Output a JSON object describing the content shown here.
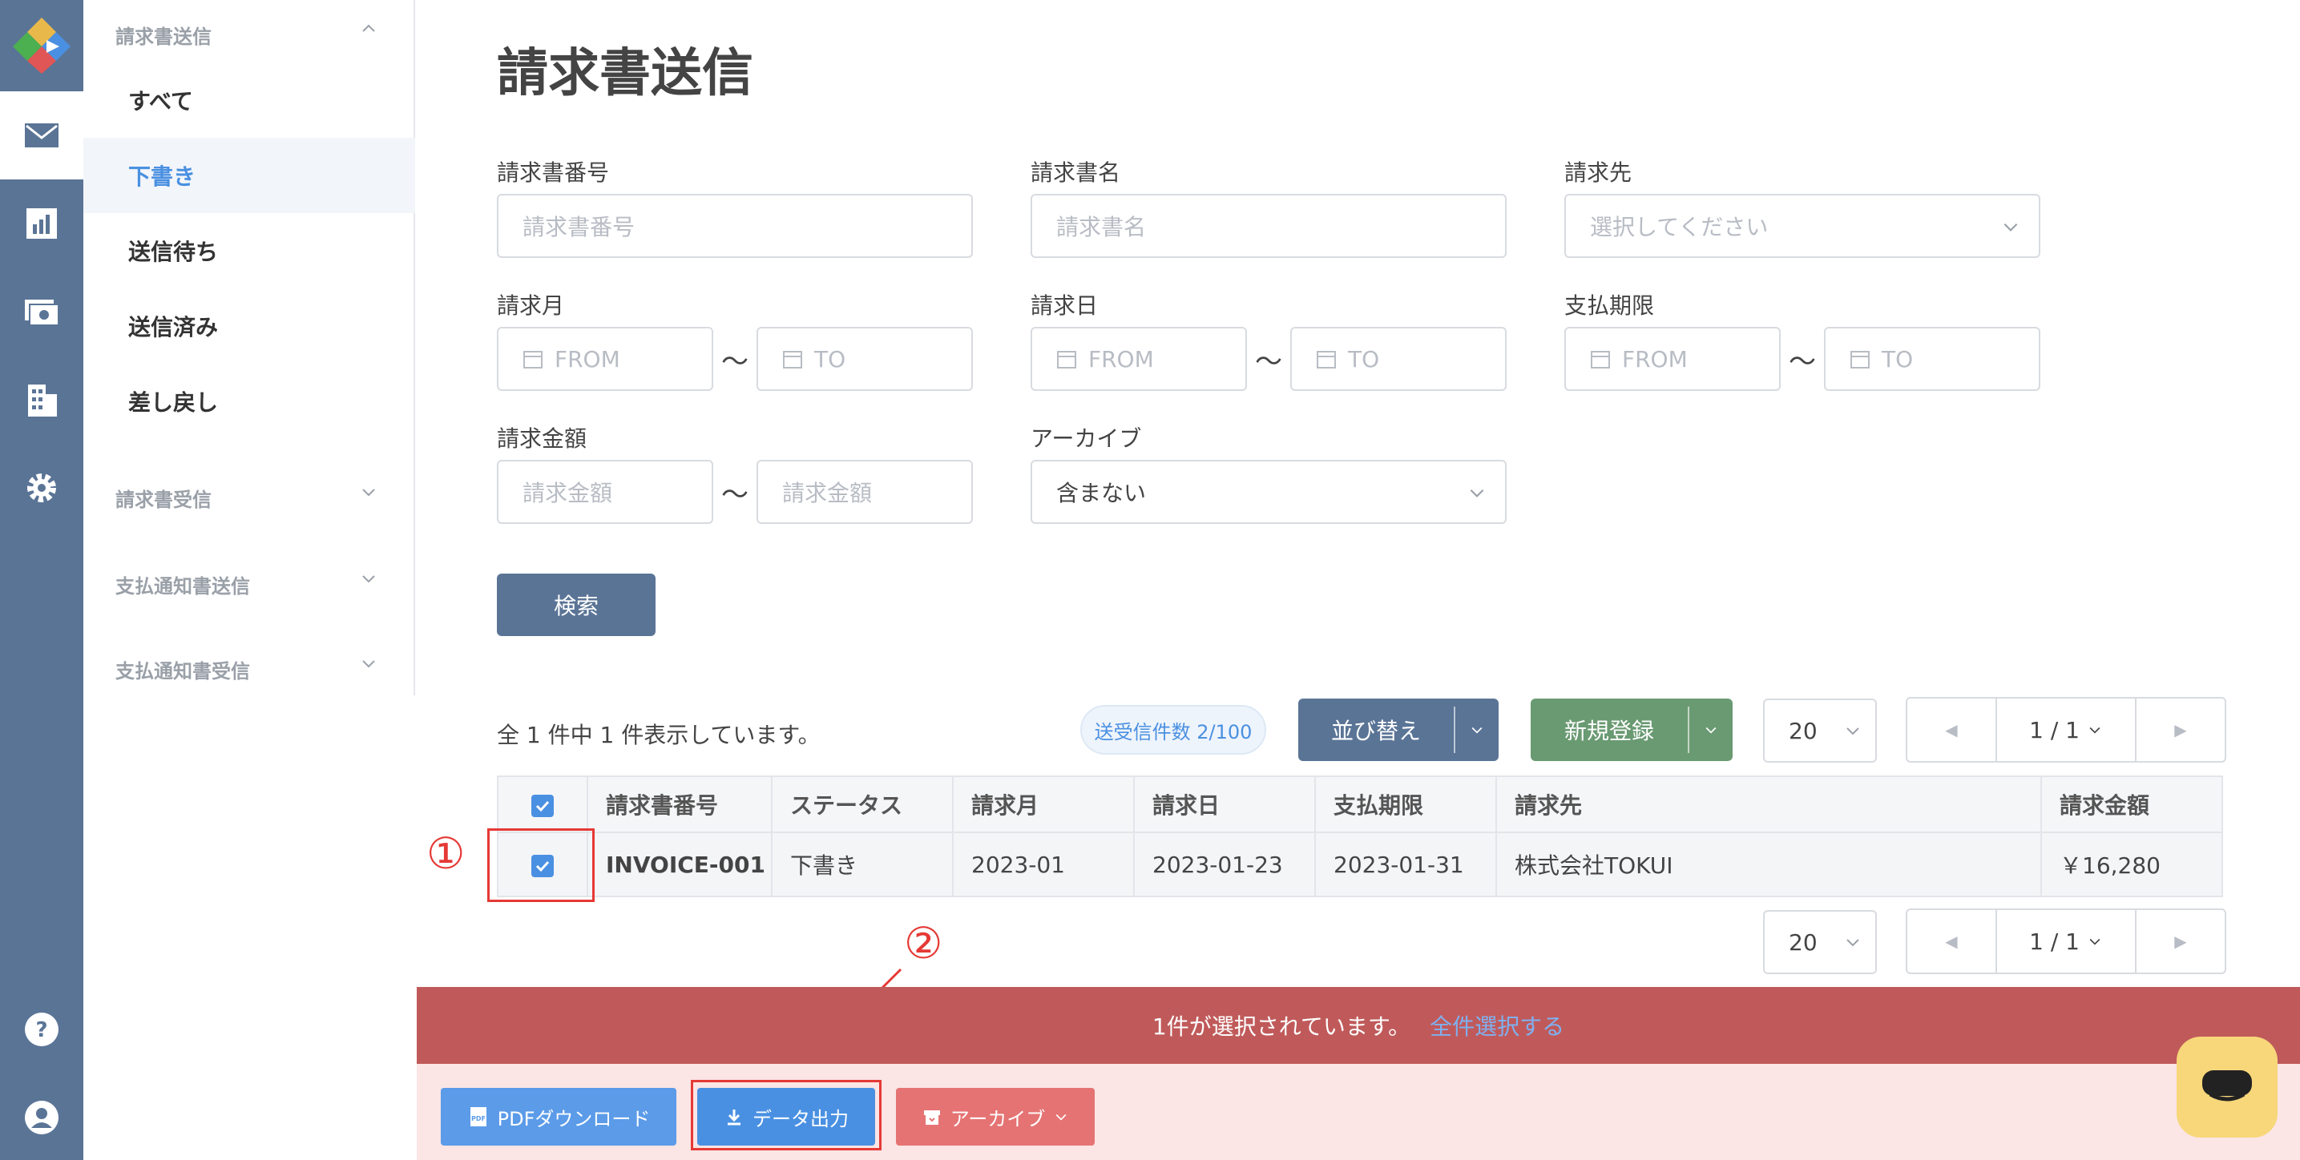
{
  "sidebar": {
    "groups": [
      {
        "label": "請求書送信"
      },
      {
        "label": "請求書受信"
      },
      {
        "label": "支払通知書送信"
      },
      {
        "label": "支払通知書受信"
      }
    ],
    "items": [
      {
        "label": "すべて"
      },
      {
        "label": "下書き"
      },
      {
        "label": "送信待ち"
      },
      {
        "label": "送信済み"
      },
      {
        "label": "差し戻し"
      }
    ]
  },
  "page": {
    "title": "請求書送信"
  },
  "filters": {
    "invoice_no": {
      "label": "請求書番号",
      "placeholder": "請求書番号"
    },
    "invoice_name": {
      "label": "請求書名",
      "placeholder": "請求書名"
    },
    "recipient": {
      "label": "請求先",
      "placeholder": "選択してください"
    },
    "billing_month": {
      "label": "請求月",
      "from": "FROM",
      "to": "TO"
    },
    "billing_date": {
      "label": "請求日",
      "from": "FROM",
      "to": "TO"
    },
    "due_date": {
      "label": "支払期限",
      "from": "FROM",
      "to": "TO"
    },
    "amount": {
      "label": "請求金額",
      "from": "請求金額",
      "to": "請求金額"
    },
    "archive": {
      "label": "アーカイブ",
      "value": "含まない"
    },
    "tilde": "〜",
    "search_label": "検索"
  },
  "results": {
    "summary": "全 1 件中 1 件表示しています。",
    "quota": "送受信件数 2/100",
    "sort_label": "並び替え",
    "new_label": "新規登録",
    "page_size": "20",
    "page_indicator": "1 / 1"
  },
  "table": {
    "headers": [
      "請求書番号",
      "ステータス",
      "請求月",
      "請求日",
      "支払期限",
      "請求先",
      "請求金額"
    ],
    "rows": [
      {
        "invoice_no": "INVOICE-001",
        "status": "下書き",
        "month": "2023-01",
        "date": "2023-01-23",
        "due": "2023-01-31",
        "recipient": "株式会社TOKUI",
        "amount": "￥16,280"
      }
    ]
  },
  "annotations": {
    "marker1": "①",
    "marker2": "②"
  },
  "selection": {
    "message": "1件が選択されています。",
    "select_all": "全件選択する"
  },
  "actions": {
    "pdf_label": "PDFダウンロード",
    "export_label": "データ出力",
    "archive_label": "アーカイブ"
  },
  "colors": {
    "rail": "#5a7496",
    "accent_blue": "#4a90e2",
    "sort_button": "#5a7496",
    "new_button": "#6a9a72",
    "selection_bar": "#c05a5a",
    "action_bar": "#fbe5e5",
    "archive_button": "#e57373",
    "annotation_red": "#e53935",
    "chat_button": "#f7d77a"
  }
}
